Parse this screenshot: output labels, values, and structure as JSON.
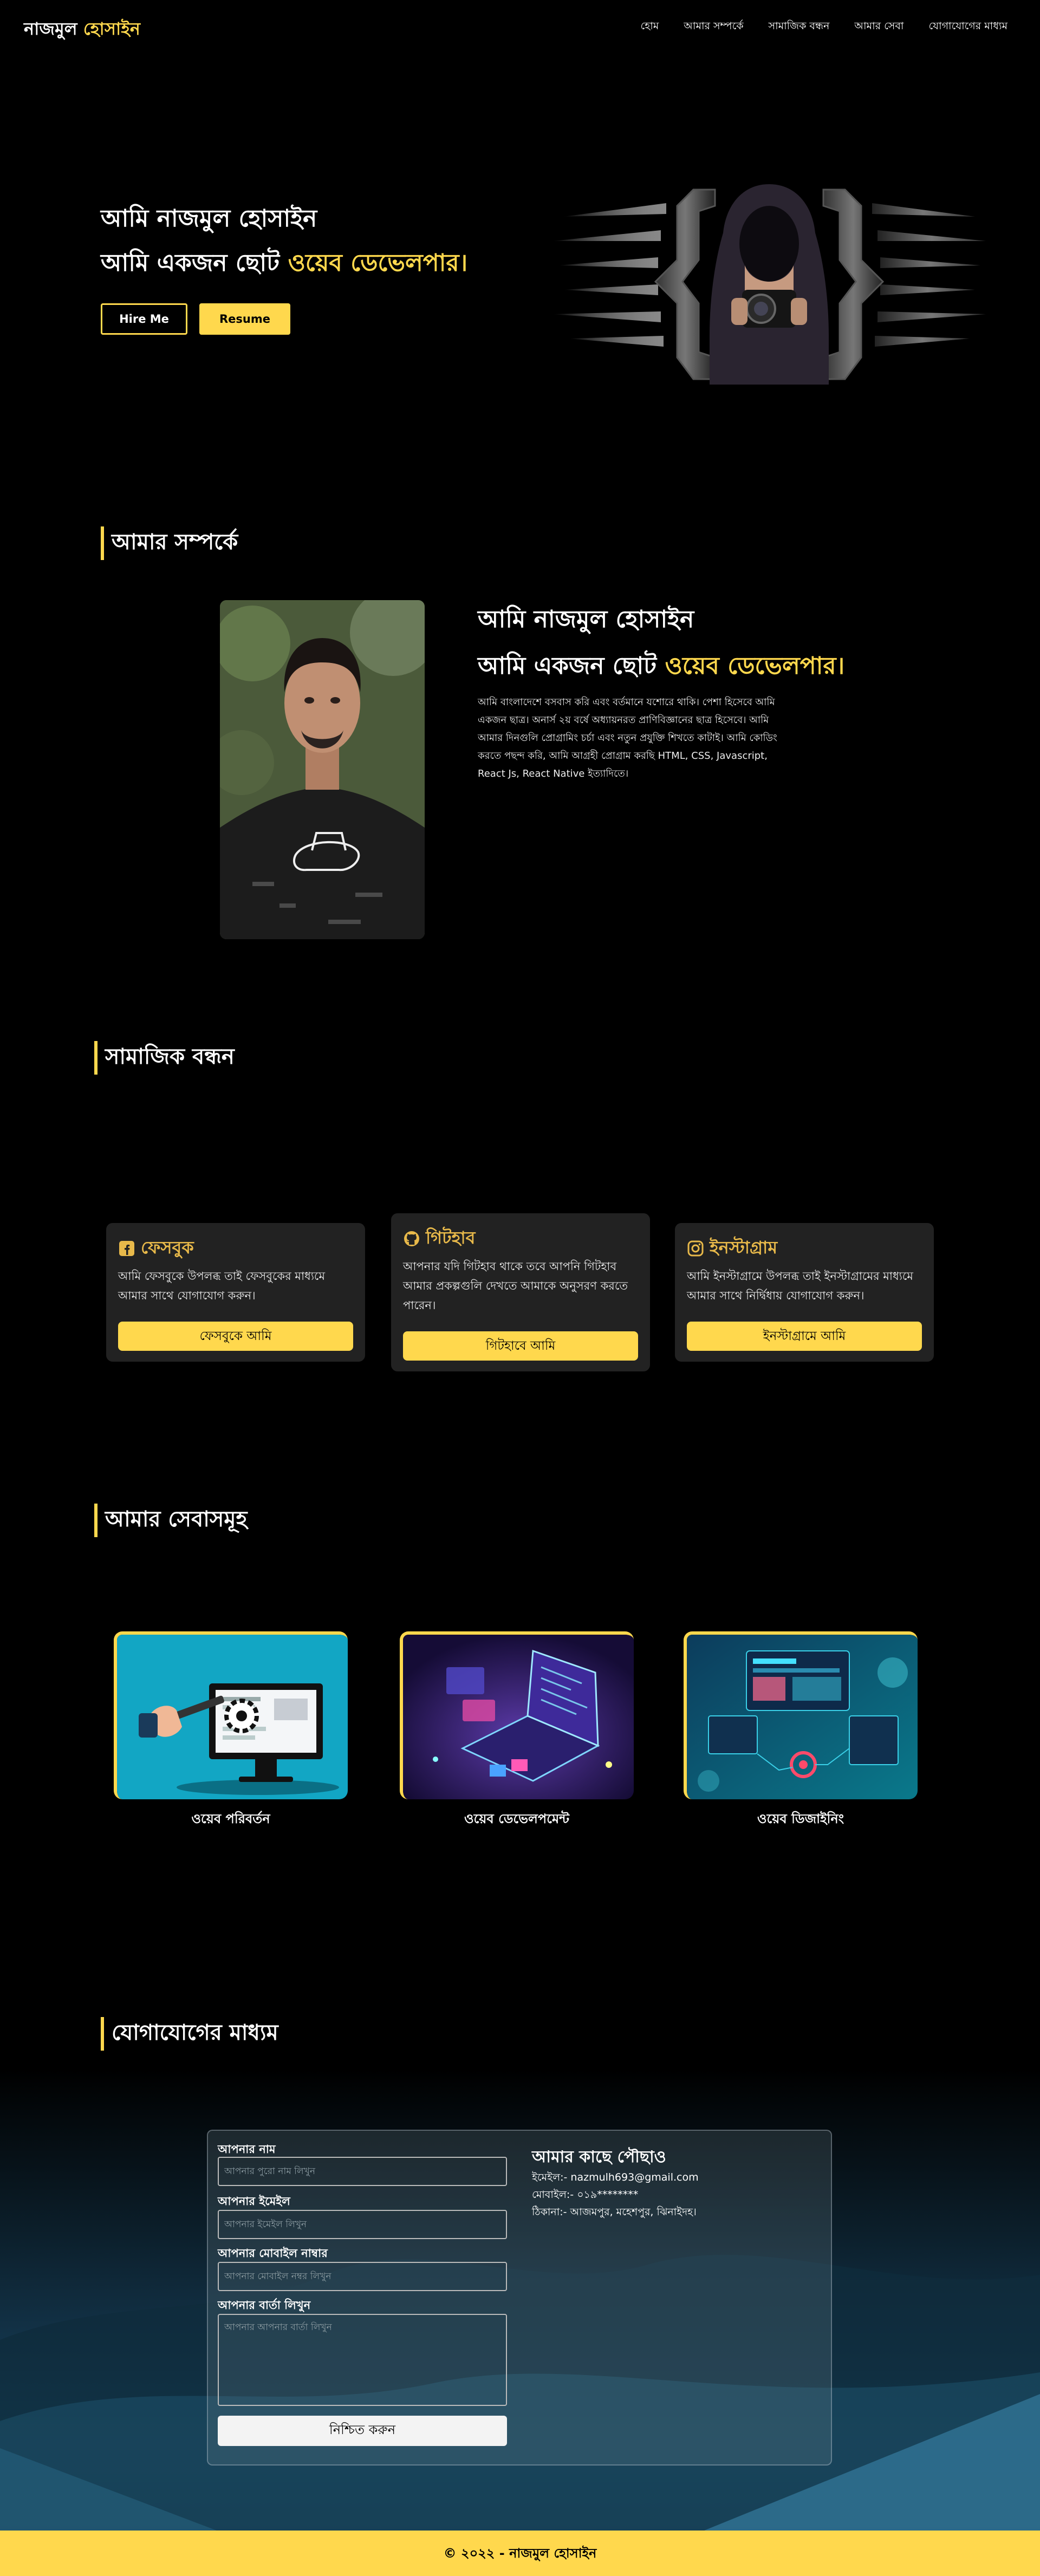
{
  "nav": {
    "logo_main": "নাজমুল",
    "logo_accent": "হোসাইন",
    "links": [
      "হোম",
      "আমার সম্পর্কে",
      "সামাজিক বন্ধন",
      "আমার সেবা",
      "যোগাযোগের মাধ্যম"
    ]
  },
  "hero": {
    "line1": "আমি নাজমুল হোসাইন",
    "line2_prefix": "আমি একজন ছোট",
    "line2_highlight": "ওয়েব ডেভেলপার।",
    "hire_button": "Hire Me",
    "resume_button": "Resume"
  },
  "about": {
    "section_title": "আমার সম্পর্কে",
    "name": "আমি নাজমুল হোসাইন",
    "role_prefix": "আমি একজন ছোট",
    "role_highlight": "ওয়েব ডেভেলপার।",
    "description": "আমি বাংলাদেশে বসবাস করি এবং বর্তমানে যশোরে থাকি। পেশা হিসেবে আমি একজন ছাত্র। অনার্স ২য় বর্ষে অধ্যায়নরত প্রাণিবিজ্ঞানের ছাত্র হিসেবে। আমি আমার দিনগুলি প্রোগ্রামিং চর্চা এবং নতুন প্রযুক্তি শিখতে কাটাই। আমি কোডিং করতে পছন্দ করি, আমি আগ্রহী প্রোগ্রাম করছি HTML, CSS, Javascript, React Js, React Native ইত্যাদিতে।"
  },
  "social": {
    "section_title": "সামাজিক বন্ধন",
    "cards": [
      {
        "title": "ফেসবুক",
        "icon": "facebook-icon",
        "text": "আমি ফেসবুকে উপলব্ধ তাই ফেসবুকের মাধ্যমে আমার সাথে যোগাযোগ করুন।",
        "button": "ফেসবুকে আমি"
      },
      {
        "title": "গিটহাব",
        "icon": "github-icon",
        "text": "আপনার যদি গিটহাব থাকে তবে আপনি গিটহাব আমার প্রকল্পগুলি দেখতে আমাকে অনুসরণ করতে পারেন।",
        "button": "গিটহাবে আমি"
      },
      {
        "title": "ইনস্টাগ্রাম",
        "icon": "instagram-icon",
        "text": "আমি ইনস্টাগ্রামে উপলব্ধ তাই ইনস্টাগ্রামের মাধ্যমে আমার সাথে নির্দ্বিধায় যোগাযোগ করুন।",
        "button": "ইনস্টাগ্রামে আমি"
      }
    ]
  },
  "services": {
    "section_title": "আমার সেবাসমূহ",
    "items": [
      {
        "label": "ওয়েব পরিবর্তন",
        "image": "web-repair-illustration"
      },
      {
        "label": "ওয়েব ডেভেলপমেন্ট",
        "image": "web-development-illustration"
      },
      {
        "label": "ওয়েব ডিজাইনিং",
        "image": "web-design-illustration"
      }
    ]
  },
  "contact": {
    "section_title": "যোগাযোগের মাধ্যম",
    "name_label": "আপনার নাম",
    "name_placeholder": "আপনার পুরো নাম লিখুন",
    "email_label": "আপনার ইমেইল",
    "email_placeholder": "আপনার ইমেইল লিখুন",
    "phone_label": "আপনার মোবাইল নাম্বার",
    "phone_placeholder": "আপনার মোবাইল নম্বর লিখুন",
    "message_label": "আপনার বার্তা লিখুন",
    "message_placeholder": "আপনার আপনার বার্তা লিখুন",
    "submit_button": "নিশ্চিত করুন",
    "reach_title": "আমার কাছে পৌছাও",
    "email_line": "ইমেইল:- nazmulh693@gmail.com",
    "phone_line": "মোবাইল:- ০১৯********",
    "address_line": "ঠিকানা:- আজমপুর, মহেশপুর, ঝিনাইদহ।"
  },
  "footer": {
    "text": "© ২০২২ - নাজমুল হোসাইন"
  },
  "colors": {
    "accent": "#ffd84d",
    "background": "#000000",
    "card": "#222222",
    "card_title": "#e8b94a"
  }
}
